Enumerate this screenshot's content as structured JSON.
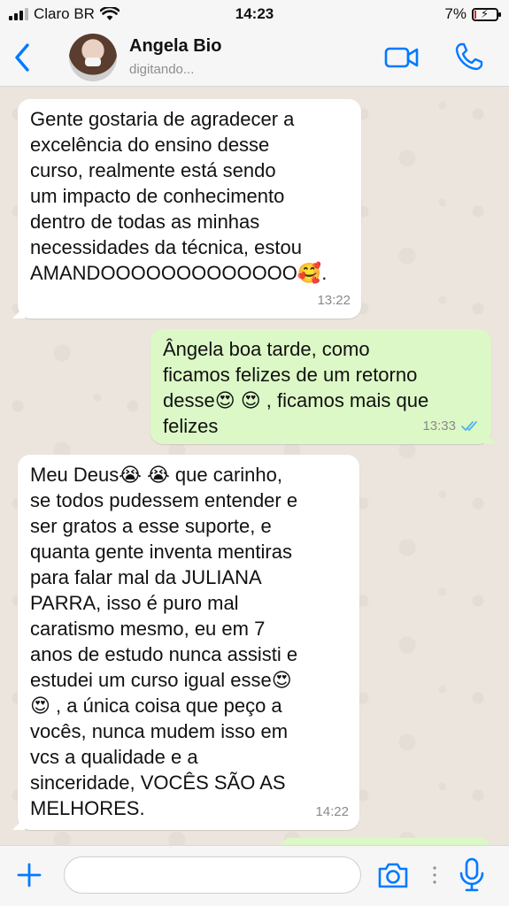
{
  "status_bar": {
    "carrier": "Claro BR",
    "time": "14:23",
    "battery": "7%",
    "battery_level": 0.07
  },
  "header": {
    "contact_name": "Angela Bio",
    "contact_status": "digitando..."
  },
  "messages": [
    {
      "direction": "in",
      "text": "Gente gostaria de agradecer a\nexcelência do ensino desse\ncurso, realmente está sendo\num impacto de conhecimento\ndentro de todas as minhas\nnecessidades da técnica, estou\nAMANDOOOOOOOOOOOOO🥰.",
      "time": "13:22"
    },
    {
      "direction": "out",
      "text": "Ângela boa tarde, como\nficamos felizes de um retorno\ndesse😍 😍 , ficamos mais que\nfelizes",
      "time": "13:33",
      "status": "read"
    },
    {
      "direction": "in",
      "text": "Meu Deus😭 😭  que carinho,\nse todos pudessem entender e\nser gratos a esse suporte, e\nquanta gente inventa mentiras\npara falar mal da JULIANA\nPARRA, isso é puro mal\ncaratismo mesmo, eu em 7\nanos de estudo nunca assisti e\nestudei um curso igual esse😍\n😍 , a única coisa que peço a\nvocês, nunca mudem isso em\nvcs a qualidade e a\nsinceridade, VOCÊS SÃO AS\nMELHORES.",
      "time": "14:22"
    }
  ],
  "input_bar": {
    "message_value": ""
  },
  "icons": {
    "back": "chevron-left-icon",
    "video": "video-camera-icon",
    "call": "phone-icon",
    "plus": "plus-icon",
    "camera": "camera-icon",
    "mic": "microphone-icon",
    "read": "double-check-icon"
  },
  "colors": {
    "accent": "#007aff",
    "incoming_bubble": "#ffffff",
    "outgoing_bubble": "#dcf8c6",
    "read_ticks": "#4fb6ec"
  }
}
